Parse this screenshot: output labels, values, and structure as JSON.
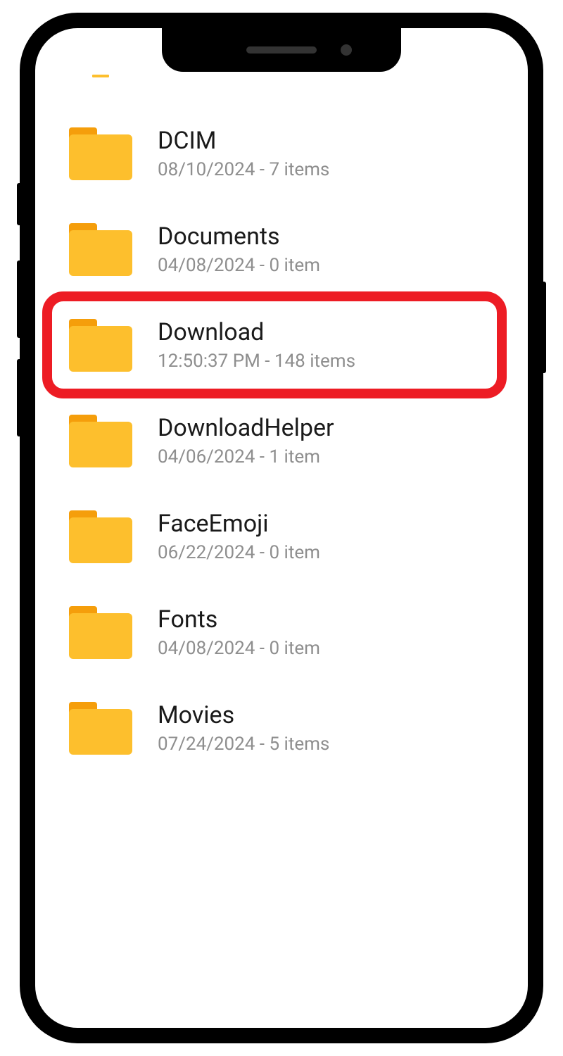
{
  "folders": [
    {
      "name": "DCIM",
      "meta": "08/10/2024 - 7 items"
    },
    {
      "name": "Documents",
      "meta": "04/08/2024 - 0 item"
    },
    {
      "name": "Download",
      "meta": "12:50:37 PM - 148 items",
      "highlighted": true
    },
    {
      "name": "DownloadHelper",
      "meta": "04/06/2024 - 1 item"
    },
    {
      "name": "FaceEmoji",
      "meta": "06/22/2024 - 0 item"
    },
    {
      "name": "Fonts",
      "meta": "04/08/2024 - 0 item"
    },
    {
      "name": "Movies",
      "meta": "07/24/2024 - 5 items"
    }
  ],
  "colors": {
    "folder_body": "#FDBF2D",
    "folder_tab": "#F59E0B",
    "highlight": "#ed1c24"
  }
}
